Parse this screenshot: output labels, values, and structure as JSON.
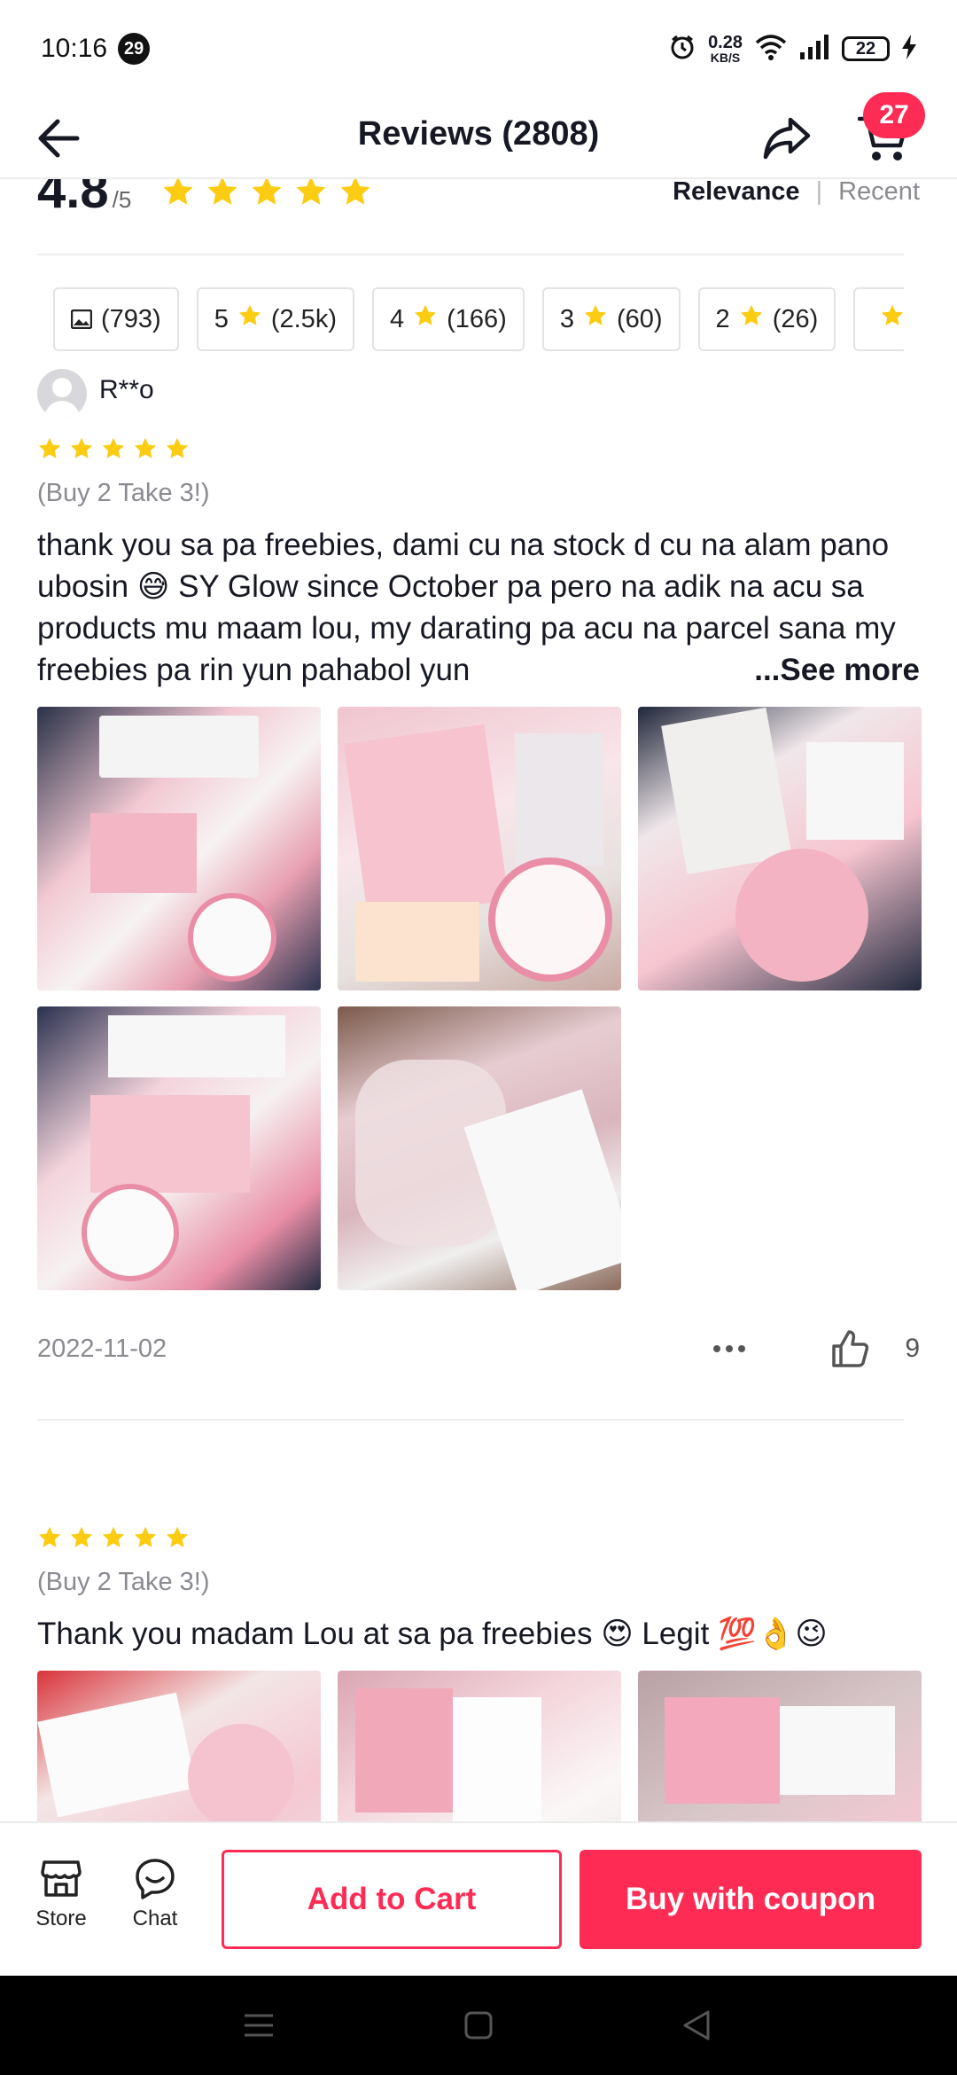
{
  "status_bar": {
    "time": "10:16",
    "notification_count": "29",
    "net_speed_value": "0.28",
    "net_speed_unit": "KB/S",
    "battery": "22"
  },
  "header": {
    "title": "Reviews (2808)",
    "cart_count": "27"
  },
  "rating": {
    "score": "4.8",
    "out_of": "/5",
    "stars": 5
  },
  "sort": {
    "active": "Relevance",
    "separator": "|",
    "inactive": "Recent"
  },
  "filters": [
    {
      "label": "(793)",
      "icon": "image-icon"
    },
    {
      "star": "5",
      "label": "(2.5k)",
      "icon": "star-icon"
    },
    {
      "star": "4",
      "label": "(166)",
      "icon": "star-icon"
    },
    {
      "star": "3",
      "label": "(60)",
      "icon": "star-icon"
    },
    {
      "star": "2",
      "label": "(26)",
      "icon": "star-icon"
    },
    {
      "star": "",
      "label": "",
      "icon": "star-icon"
    }
  ],
  "reviews": [
    {
      "username": "R**o",
      "stars": 5,
      "variant": "(Buy 2 Take 3!)",
      "text": "thank you sa pa freebies, dami cu na stock d cu na alam pano ubosin 😅 SY Glow since October pa pero na adik na acu sa products mu maam lou, my darating pa acu na parcel sana my freebies pa rin yun pahabol yun",
      "see_more": "...See more",
      "date": "2022-11-02",
      "likes": "9",
      "photo_count": 5
    },
    {
      "username": "",
      "stars": 5,
      "variant": "(Buy 2 Take 3!)",
      "text": "Thank you madam Lou at sa pa freebies 😍 Legit 💯👌😉",
      "photo_count": 3
    }
  ],
  "action_bar": {
    "store_label": "Store",
    "chat_label": "Chat",
    "add_to_cart": "Add to Cart",
    "buy": "Buy with coupon"
  },
  "colors": {
    "accent": "#fe2c55",
    "star": "#fccc12",
    "text_secondary": "#8a8b91"
  }
}
